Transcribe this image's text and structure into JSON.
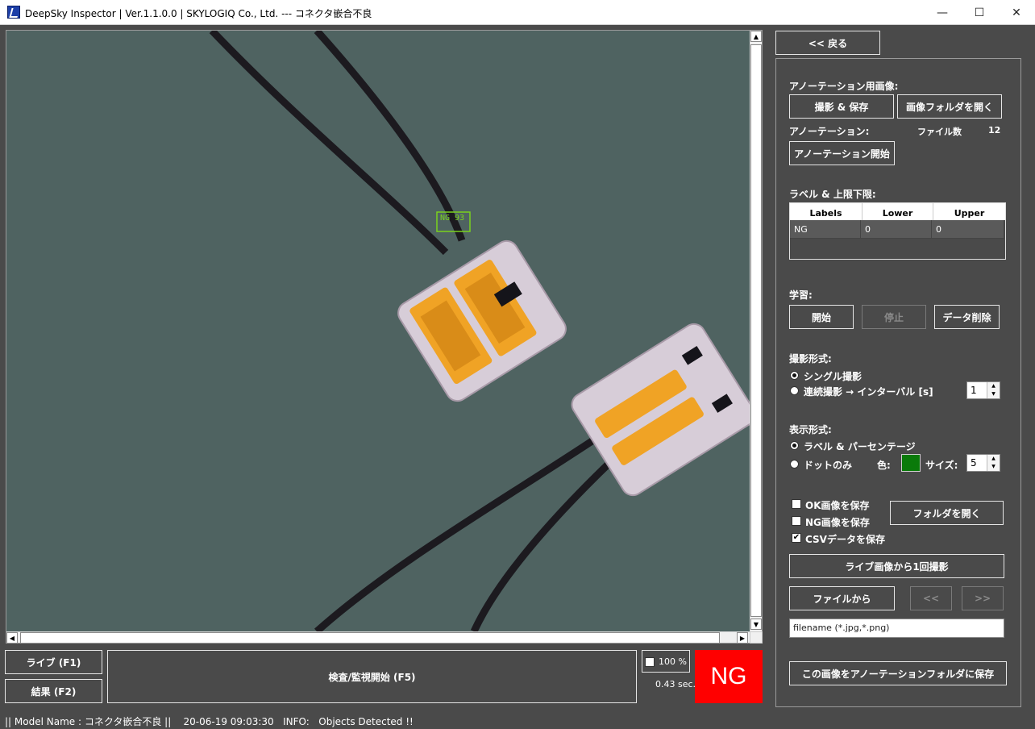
{
  "window": {
    "title": "DeepSky Inspector | Ver.1.1.0.0 | SKYLOGIQ Co., Ltd. --- コネクタ嵌合不良",
    "minimize": "—",
    "maximize": "☐",
    "close": "✕"
  },
  "viewer": {
    "detection_label": "NG 93",
    "detection_color": "#7ad21e",
    "background_color": "#4f6361"
  },
  "bottom": {
    "live_button": "ライブ (F1)",
    "result_button": "結果 (F2)",
    "inspect_button": "検査/監視開始 (F5)",
    "zoom_label": "100 %",
    "time_label": "0.43 sec.",
    "verdict": "NG",
    "verdict_color": "#ff0000"
  },
  "panel": {
    "back_button": "<< 戻る",
    "annotation_image_label": "アノーテーション用画像:",
    "capture_save_button": "撮影 & 保存",
    "open_image_folder_button": "画像フォルダを開く",
    "annotation_label": "アノーテーション:",
    "file_count_label": "ファイル数",
    "file_count": "12",
    "start_annotation_button": "アノーテーション開始",
    "label_limits_heading": "ラベル & 上限下限:",
    "table": {
      "columns": [
        "Labels",
        "Lower",
        "Upper"
      ],
      "rows": [
        [
          "NG",
          "0",
          "0"
        ]
      ]
    },
    "learning_heading": "学習:",
    "learn_start_button": "開始",
    "learn_stop_button": "停止",
    "delete_data_button": "データ削除",
    "capture_mode_heading": "撮影形式:",
    "single_capture": "シングル撮影",
    "continuous_capture": "連続撮影 → インターバル [s]",
    "interval_value": "1",
    "display_mode_heading": "表示形式:",
    "label_percentage": "ラベル & パーセンテージ",
    "dot_only": "ドットのみ",
    "color_label": "色:",
    "dot_color": "#0a7a0a",
    "size_label": "サイズ:",
    "size_value": "5",
    "save_ok_images": "OK画像を保存",
    "save_ng_images": "NG画像を保存",
    "save_csv": "CSVデータを保存",
    "open_folder_button": "フォルダを開く",
    "capture_once_button": "ライブ画像から1回撮影",
    "from_file_button": "ファイルから",
    "prev_button": "<<",
    "next_button": ">>",
    "filename_placeholder": "filename (*.jpg,*.png)",
    "save_to_annotation_button": "この画像をアノーテーションフォルダに保存"
  },
  "status_bar": {
    "text": "|| Model Name : コネクタ嵌合不良 ||    20-06-19 09:03:30   INFO:   Objects Detected !!"
  }
}
